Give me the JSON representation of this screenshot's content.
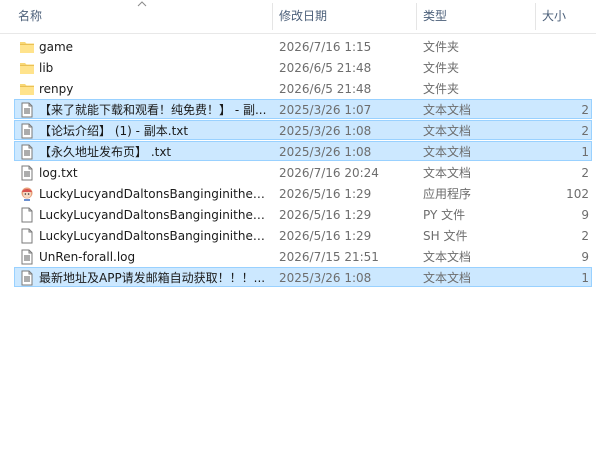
{
  "columns": {
    "name": "名称",
    "date": "修改日期",
    "type": "类型",
    "size": "大小"
  },
  "files": [
    {
      "name": "game",
      "date": "2026/7/16 1:15",
      "type": "文件夹",
      "size": "",
      "icon": "folder-icon",
      "selected": false
    },
    {
      "name": "lib",
      "date": "2026/6/5 21:48",
      "type": "文件夹",
      "size": "",
      "icon": "folder-icon",
      "selected": false
    },
    {
      "name": "renpy",
      "date": "2026/6/5 21:48",
      "type": "文件夹",
      "size": "",
      "icon": "folder-icon",
      "selected": false
    },
    {
      "name": "【来了就能下载和观看！纯免费！】 - 副...",
      "date": "2025/3/26 1:07",
      "type": "文本文档",
      "size": "2",
      "icon": "text-file-icon",
      "selected": true
    },
    {
      "name": "【论坛介绍】 (1) - 副本.txt",
      "date": "2025/3/26 1:08",
      "type": "文本文档",
      "size": "2",
      "icon": "text-file-icon",
      "selected": true
    },
    {
      "name": "【永久地址发布页】 .txt",
      "date": "2025/3/26 1:08",
      "type": "文本文档",
      "size": "1",
      "icon": "text-file-icon",
      "selected": true
    },
    {
      "name": "log.txt",
      "date": "2026/7/16 20:24",
      "type": "文本文档",
      "size": "2",
      "icon": "text-file-icon",
      "selected": false
    },
    {
      "name": "LuckyLucyandDaltonsBanginginitheWil...",
      "date": "2026/5/16 1:29",
      "type": "应用程序",
      "size": "102",
      "icon": "app-icon",
      "selected": false
    },
    {
      "name": "LuckyLucyandDaltonsBanginginitheWil...",
      "date": "2026/5/16 1:29",
      "type": "PY 文件",
      "size": "9",
      "icon": "blank-file-icon",
      "selected": false
    },
    {
      "name": "LuckyLucyandDaltonsBanginginitheWil...",
      "date": "2026/5/16 1:29",
      "type": "SH 文件",
      "size": "2",
      "icon": "blank-file-icon",
      "selected": false
    },
    {
      "name": "UnRen-forall.log",
      "date": "2026/7/15 21:51",
      "type": "文本文档",
      "size": "9",
      "icon": "text-file-icon",
      "selected": false
    },
    {
      "name": "最新地址及APP请发邮箱自动获取！！！...",
      "date": "2025/3/26 1:08",
      "type": "文本文档",
      "size": "1",
      "icon": "text-file-icon",
      "selected": true
    }
  ]
}
